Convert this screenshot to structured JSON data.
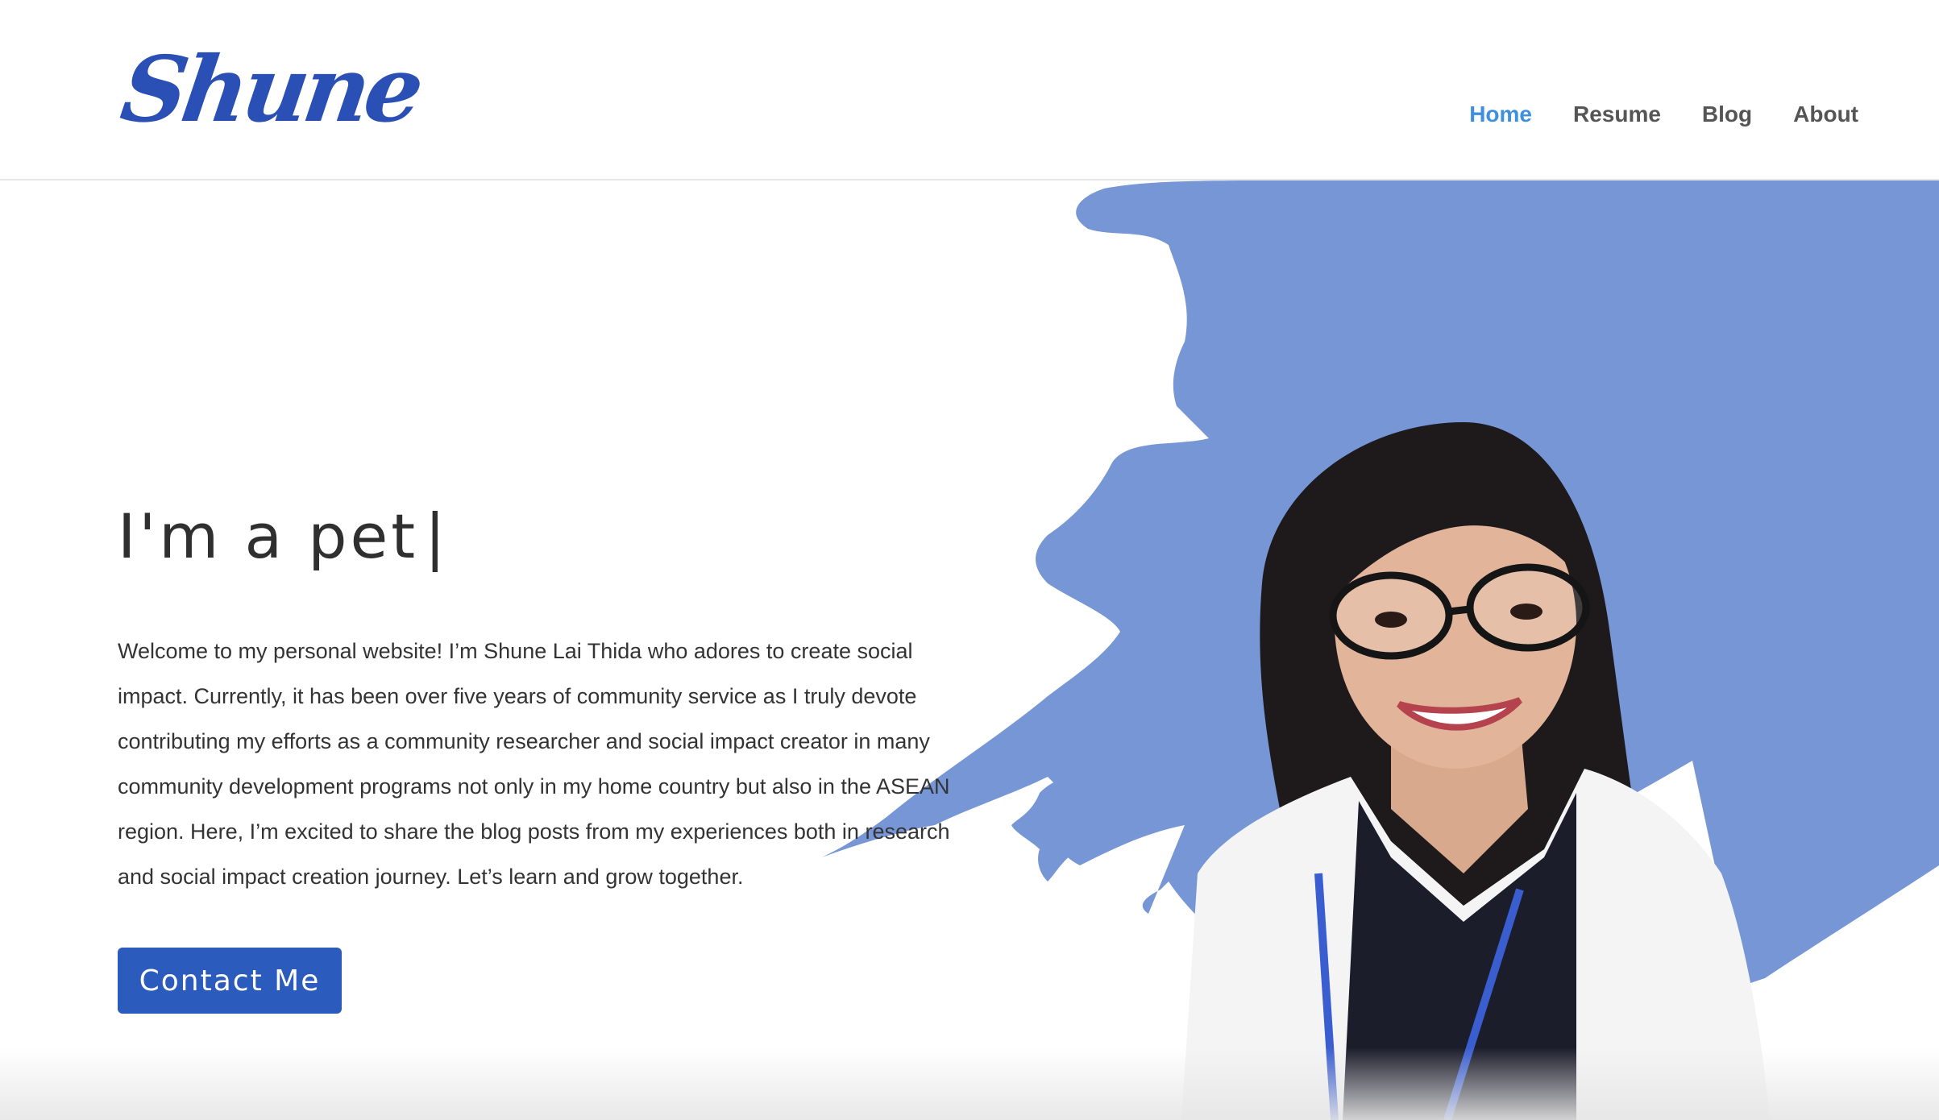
{
  "brand": {
    "logo_text": "Shune",
    "logo_color": "#2a4fb5"
  },
  "nav": {
    "items": [
      {
        "label": "Home",
        "active": true
      },
      {
        "label": "Resume",
        "active": false
      },
      {
        "label": "Blog",
        "active": false
      },
      {
        "label": "About",
        "active": false
      }
    ],
    "active_color": "#3f8fe0",
    "default_color": "#555555"
  },
  "hero": {
    "headline": "I'm a pet",
    "cursor": "|",
    "intro": "Welcome to my personal website! I’m Shune Lai Thida who adores to create social impact. Currently, it has been over five years of community service as I truly devote contributing my efforts as a community researcher and social impact creator in many community development programs not only in my home country but also in the ASEAN region. Here, I’m excited to share the blog posts from my experiences both in research and social impact creation journey. Let’s learn and grow together.",
    "cta_label": "Contact Me",
    "cta_color": "#2b5bbd",
    "accent_blob_color": "#7796d6"
  },
  "icons": {
    "portrait": "person-portrait-image"
  }
}
